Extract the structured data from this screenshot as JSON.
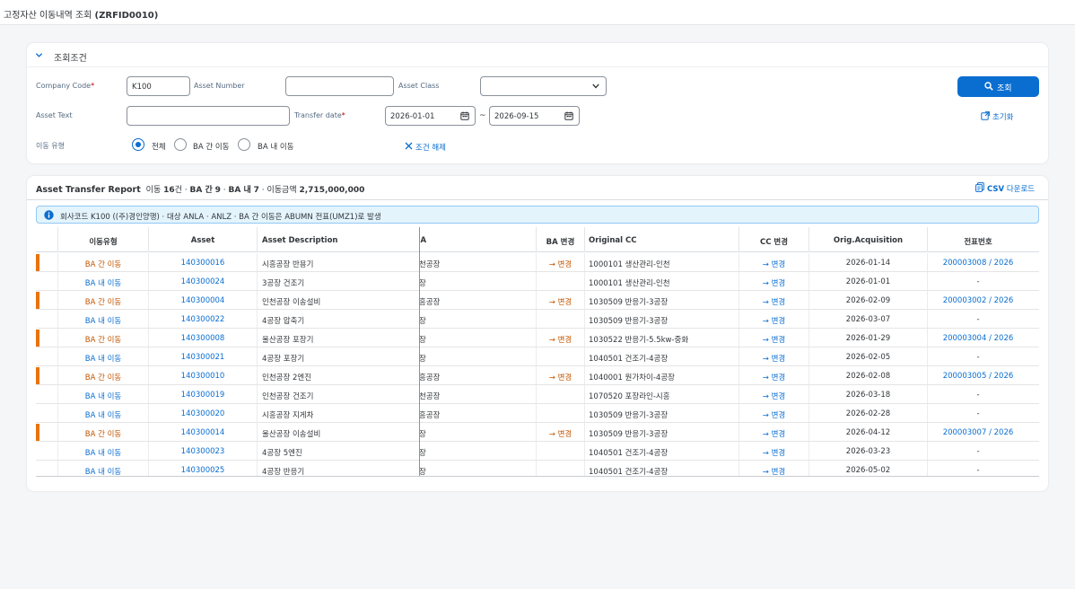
{
  "app": {
    "title_prefix": "고정자산 이동내역 조회",
    "title_code": "(ZRFID0010)"
  },
  "filter": {
    "title": "조회조건",
    "company_code": {
      "label": "Company Code",
      "value": "K100"
    },
    "asset_number": {
      "label": "Asset Number",
      "value": ""
    },
    "asset_class": {
      "label": "Asset Class",
      "value": ""
    },
    "asset_text": {
      "label": "Asset Text",
      "value": ""
    },
    "transfer_date": {
      "label": "Transfer date",
      "from": "2026-01-01",
      "to": "2026-09-15",
      "separator": "~"
    },
    "move_type": {
      "label": "이동 유형",
      "options": [
        "전체",
        "BA 간 이동",
        "BA 내 이동"
      ],
      "selected": "전체"
    },
    "clear_label": "조건 해제",
    "search_label": "조회",
    "reset_label": "초기화"
  },
  "report": {
    "title": "Asset Transfer Report",
    "summary": {
      "count_prefix": "이동",
      "count": "16",
      "count_unit": "건",
      "inter_label": "BA 간",
      "inter_count": "9",
      "intra_label": "BA 내",
      "intra_count": "7",
      "amount_label": "이동금액",
      "amount": "2,715,000,000"
    },
    "csv_label": "CSV",
    "csv_suffix": "다운로드",
    "info": "회사코드 K100 ((주)경인양행) · 대상 ANLA · ANLZ · BA 간 이동은 ABUMN 전표(UMZ1)로 발생",
    "columns": [
      "이동유형",
      "Asset",
      "Asset Description",
      "BA",
      "BA 변경",
      "Original CC",
      "CC 변경",
      "Orig.Acquisition",
      "전표번호"
    ],
    "rows": [
      {
        "type": "BA 간 이동",
        "asset": "140300016",
        "desc": "시흥공장 반용기",
        "ba": "천공장",
        "ba_change": "→ 변경",
        "cc": "1000101 생산관리-인천",
        "cc_change": "→ 변경",
        "acq": "2026-01-14",
        "doc": "200003008 / 2026"
      },
      {
        "type": "BA 내 이동",
        "asset": "140300024",
        "desc": "3공장 건조기",
        "ba": "장",
        "ba_change": "",
        "cc": "1000101 생산관리-인천",
        "cc_change": "→ 변경",
        "acq": "2026-01-01",
        "doc": "-"
      },
      {
        "type": "BA 간 이동",
        "asset": "140300004",
        "desc": "인천공장 이송설비",
        "ba": "흥공장",
        "ba_change": "→ 변경",
        "cc": "1030509 반응기-3공장",
        "cc_change": "→ 변경",
        "acq": "2026-02-09",
        "doc": "200003002 / 2026"
      },
      {
        "type": "BA 내 이동",
        "asset": "140300022",
        "desc": "4공장 압축기",
        "ba": "장",
        "ba_change": "",
        "cc": "1030509 반응기-3공장",
        "cc_change": "→ 변경",
        "acq": "2026-03-07",
        "doc": "-"
      },
      {
        "type": "BA 간 이동",
        "asset": "140300008",
        "desc": "울산공장 포장기",
        "ba": "장",
        "ba_change": "→ 변경",
        "cc": "1030522 반응기-5.5kw-중화",
        "cc_change": "→ 변경",
        "acq": "2026-01-29",
        "doc": "200003004 / 2026"
      },
      {
        "type": "BA 내 이동",
        "asset": "140300021",
        "desc": "4공장 포장기",
        "ba": "장",
        "ba_change": "",
        "cc": "1040501 건조기-4공장",
        "cc_change": "→ 변경",
        "acq": "2026-02-05",
        "doc": "-"
      },
      {
        "type": "BA 간 이동",
        "asset": "140300010",
        "desc": "인천공장 2엔진",
        "ba": "흥공장",
        "ba_change": "→ 변경",
        "cc": "1040001 원가차이-4공장",
        "cc_change": "→ 변경",
        "acq": "2026-02-08",
        "doc": "200003005 / 2026"
      },
      {
        "type": "BA 내 이동",
        "asset": "140300019",
        "desc": "인천공장 건조기",
        "ba": "천공장",
        "ba_change": "",
        "cc": "1070520 포장라인-시흥",
        "cc_change": "→ 변경",
        "acq": "2026-03-18",
        "doc": "-"
      },
      {
        "type": "BA 내 이동",
        "asset": "140300020",
        "desc": "시흥공장 지게차",
        "ba": "흥공장",
        "ba_change": "",
        "cc": "1030509 반응기-3공장",
        "cc_change": "→ 변경",
        "acq": "2026-02-28",
        "doc": "-"
      },
      {
        "type": "BA 간 이동",
        "asset": "140300014",
        "desc": "울산공장 이송설비",
        "ba": "장",
        "ba_change": "→ 변경",
        "cc": "1030509 반응기-3공장",
        "cc_change": "→ 변경",
        "acq": "2026-04-12",
        "doc": "200003007 / 2026"
      },
      {
        "type": "BA 내 이동",
        "asset": "140300023",
        "desc": "4공장 5엔진",
        "ba": "장",
        "ba_change": "",
        "cc": "1040501 건조기-4공장",
        "cc_change": "→ 변경",
        "acq": "2026-03-23",
        "doc": "-"
      },
      {
        "type": "BA 내 이동",
        "asset": "140300025",
        "desc": "4공장 반응기",
        "ba": "장",
        "ba_change": "",
        "cc": "1040501 건조기-4공장",
        "cc_change": "→ 변경",
        "acq": "2026-05-02",
        "doc": "-"
      }
    ]
  },
  "colors": {
    "primary": "#0a6ed1",
    "inter_ba": "#c35500",
    "highlight_bar": "#e9730c",
    "info_bg": "#e4f4fd"
  },
  "icons": [
    "chevron-down-icon",
    "dropdown-arrow-icon",
    "calendar-icon",
    "search-icon",
    "close-icon",
    "reset-icon",
    "csv-icon",
    "info-icon"
  ]
}
